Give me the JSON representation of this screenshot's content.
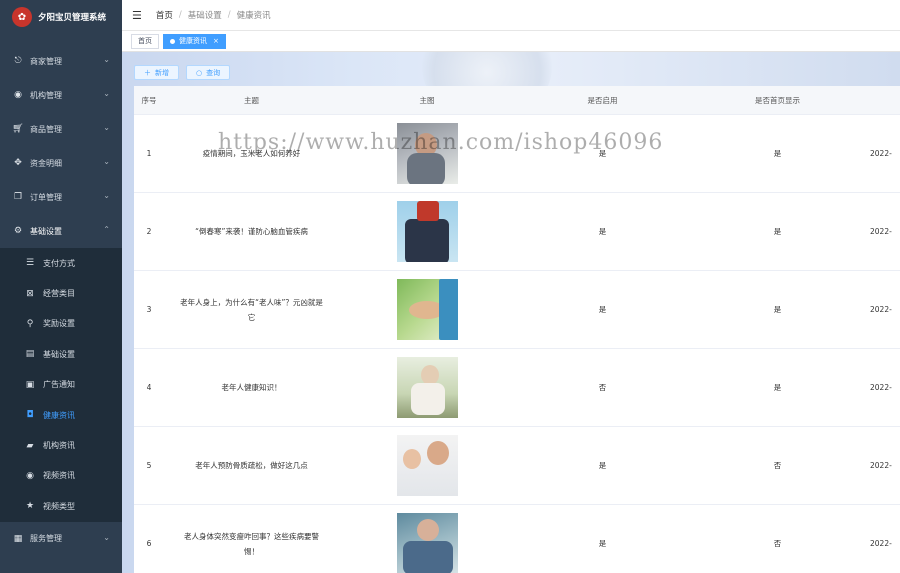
{
  "brand": {
    "title": "夕阳宝贝管理系统"
  },
  "sidebar": {
    "items": [
      {
        "label": "商家管理",
        "icon": "merchant-icon"
      },
      {
        "label": "机构管理",
        "icon": "github-icon"
      },
      {
        "label": "商品管理",
        "icon": "cart-icon"
      },
      {
        "label": "资金明细",
        "icon": "move-icon"
      },
      {
        "label": "订单管理",
        "icon": "copy-icon"
      },
      {
        "label": "基础设置",
        "icon": "gear-icon"
      }
    ],
    "sub_items": [
      {
        "label": "支付方式",
        "icon": "list-icon"
      },
      {
        "label": "经营类目",
        "icon": "box-icon"
      },
      {
        "label": "奖励设置",
        "icon": "tree-icon"
      },
      {
        "label": "基础设置",
        "icon": "monitor-icon"
      },
      {
        "label": "广告通知",
        "icon": "image-icon"
      },
      {
        "label": "健康资讯",
        "icon": "info-icon"
      },
      {
        "label": "机构资讯",
        "icon": "folder-icon"
      },
      {
        "label": "视频资讯",
        "icon": "radio-icon"
      },
      {
        "label": "视频类型",
        "icon": "star-icon"
      }
    ],
    "bottom_item": {
      "label": "服务管理",
      "icon": "grid-icon"
    },
    "active_sub": "健康资讯"
  },
  "breadcrumb": {
    "home": "首页",
    "section": "基础设置",
    "current": "健康资讯"
  },
  "tags": {
    "home": "首页",
    "active": "健康资讯"
  },
  "toolbar": {
    "add_label": "新增",
    "search_label": "查询"
  },
  "table": {
    "headers": [
      "序号",
      "主题",
      "主图",
      "是否启用",
      "是否首页显示"
    ],
    "rows": [
      {
        "no": "1",
        "title": "疫情期间，玉米老人如何养好",
        "enabled": "是",
        "home": "是",
        "date": "2022-"
      },
      {
        "no": "2",
        "title": "“倒春寒”来袭！谨防心脑血管疾病",
        "enabled": "是",
        "home": "是",
        "date": "2022-"
      },
      {
        "no": "3",
        "title": "老年人身上，为什么有“老人味”？元凶就是它",
        "enabled": "是",
        "home": "是",
        "date": "2022-"
      },
      {
        "no": "4",
        "title": "老年人健康知识！",
        "enabled": "否",
        "home": "是",
        "date": "2022-"
      },
      {
        "no": "5",
        "title": "老年人预防骨质疏松，做好这几点",
        "enabled": "是",
        "home": "否",
        "date": "2022-"
      },
      {
        "no": "6",
        "title": "老人身体突然变瘦咋回事？这些疾病要警惕！",
        "enabled": "是",
        "home": "否",
        "date": "2022-"
      }
    ]
  },
  "watermark": "https://www.huzhan.com/ishop46096",
  "colors": {
    "sidebar_bg": "#2e3e50",
    "accent": "#409eff"
  }
}
